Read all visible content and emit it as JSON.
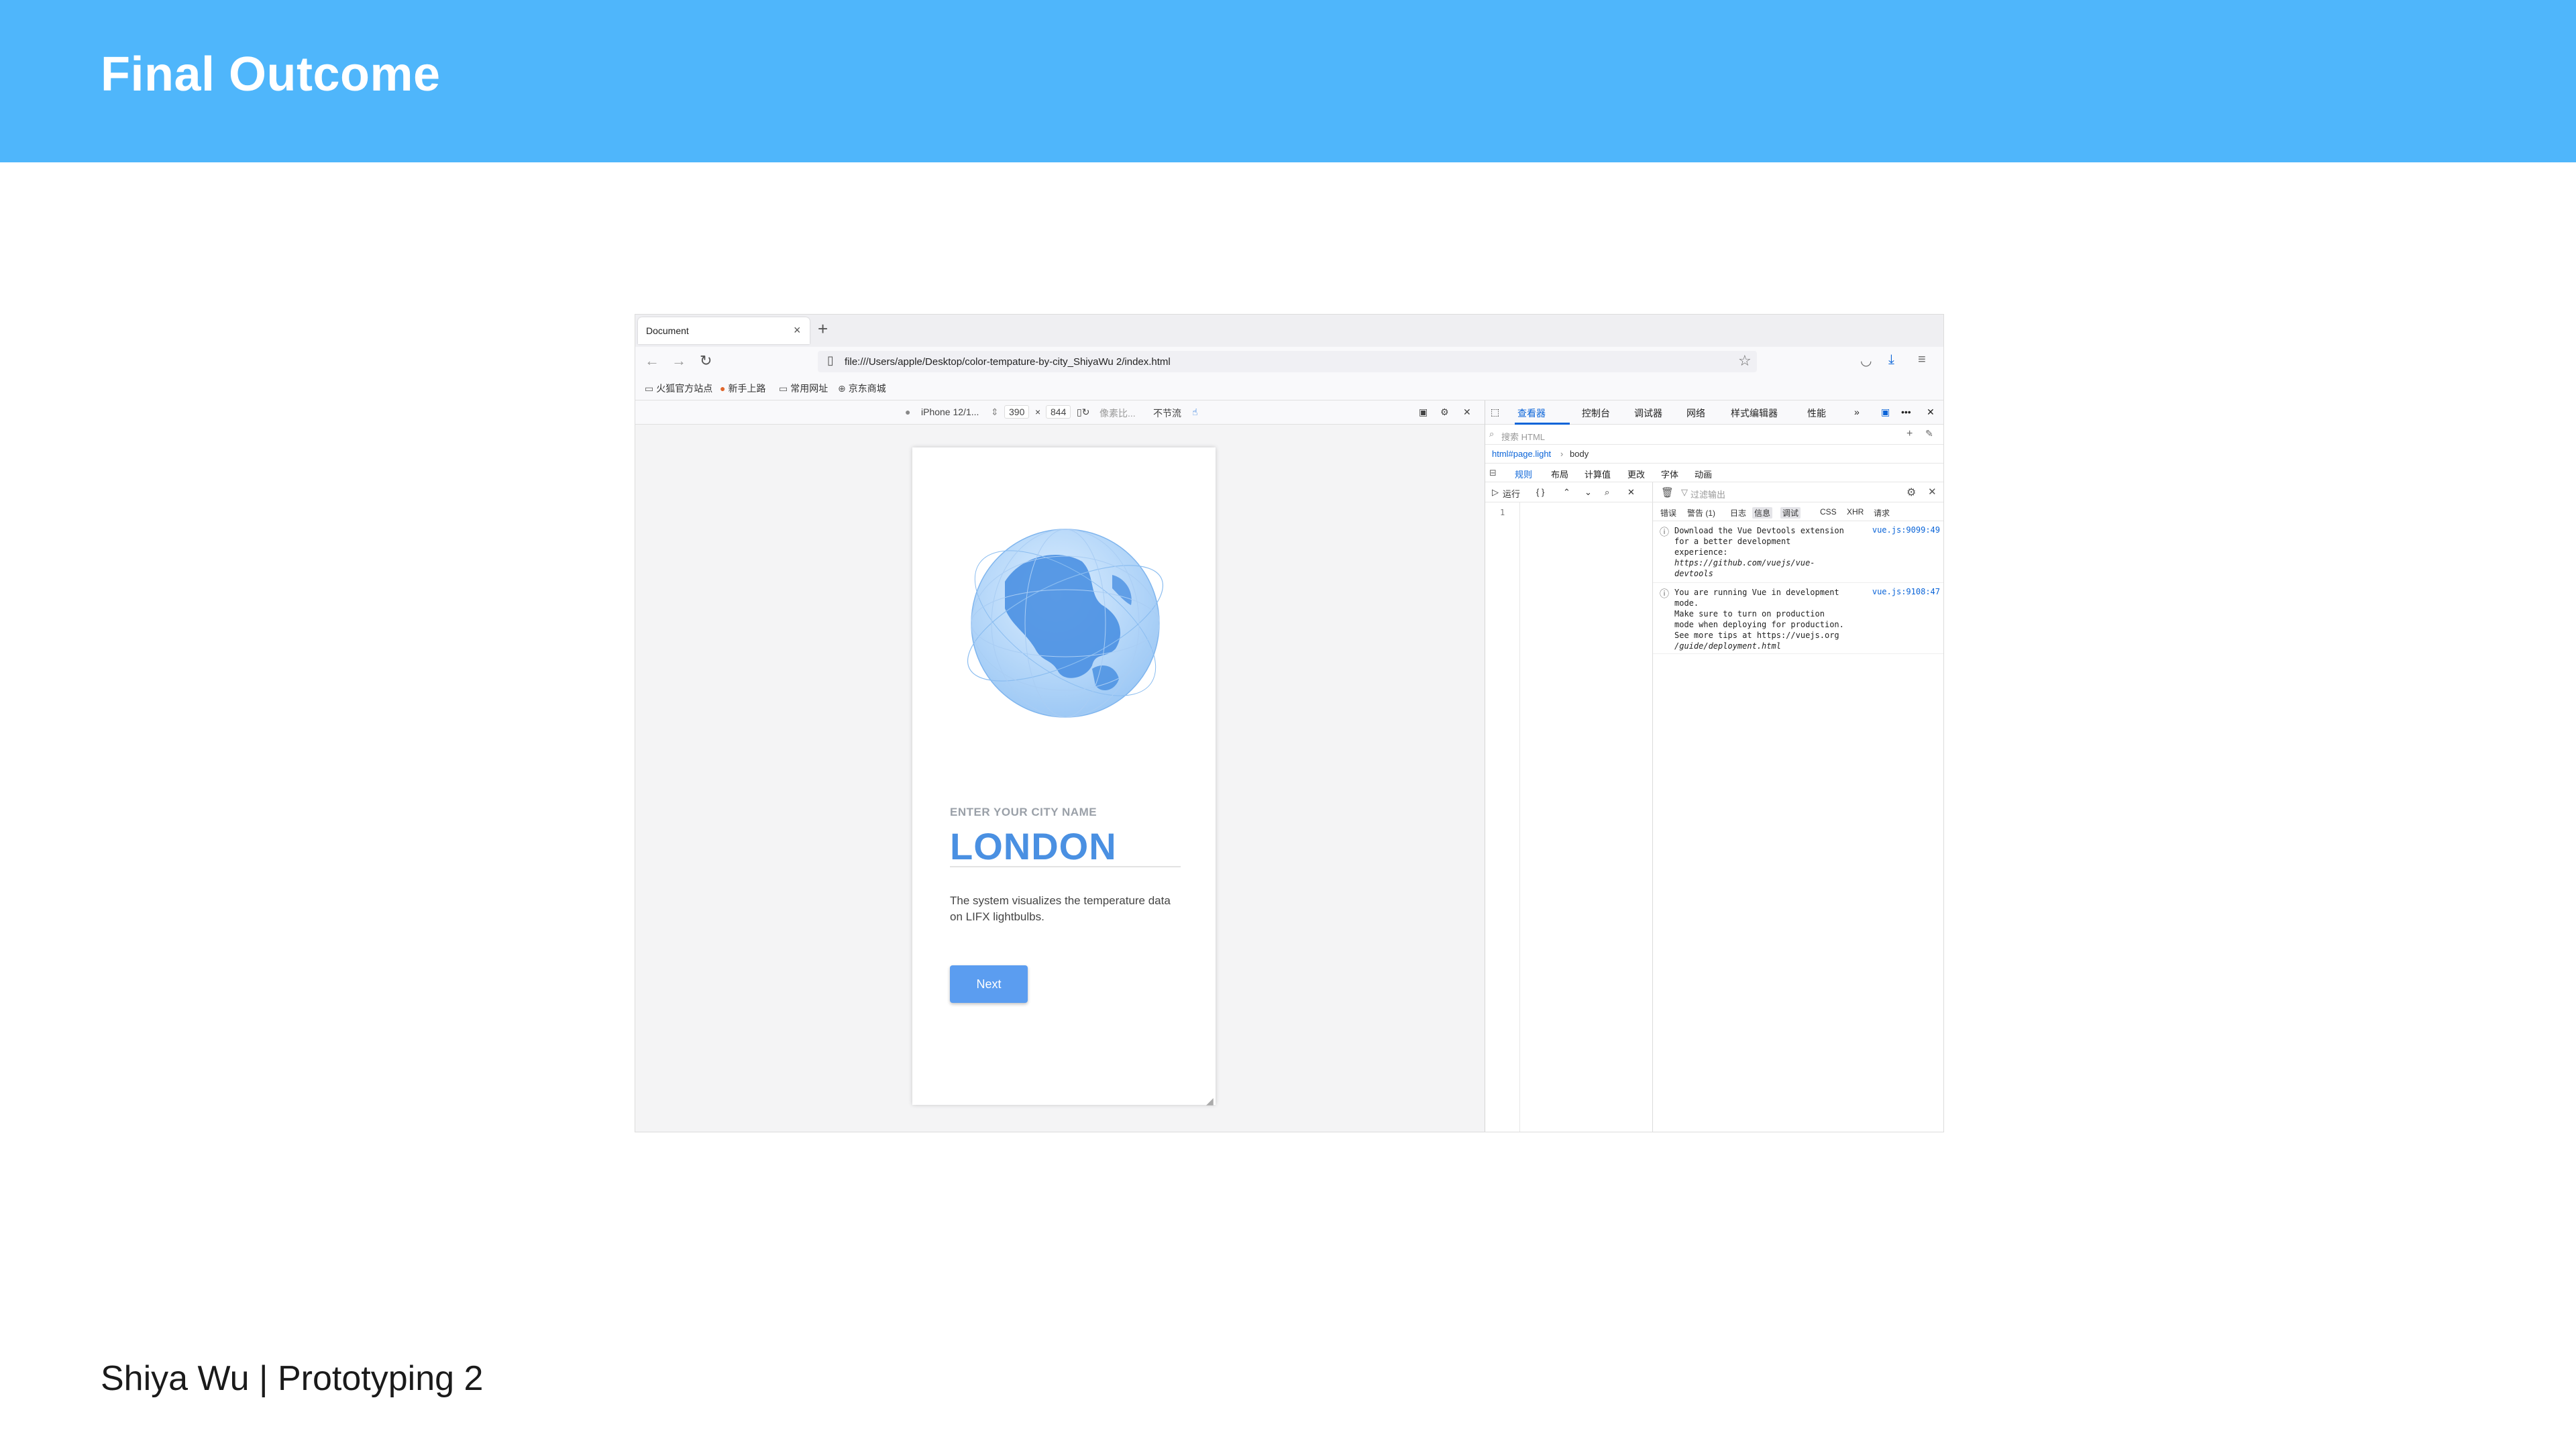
{
  "slide": {
    "title": "Final Outcome",
    "footer": "Shiya Wu | Prototyping 2",
    "header_color": "#4fb6fb"
  },
  "browser": {
    "tab_title": "Document",
    "tab_close": "×",
    "new_tab": "+",
    "url": "file:///Users/apple/Desktop/color-tempature-by-city_ShiyaWu 2/index.html",
    "bookmarks": [
      "火狐官方站点",
      "新手上路",
      "常用网址",
      "京东商城"
    ]
  },
  "rdm": {
    "device": "iPhone 12/1...",
    "width": "390",
    "times": "×",
    "height": "844",
    "dpr": "像素比...",
    "throttle": "不节流"
  },
  "app": {
    "city_label": "ENTER YOUR CITY NAME",
    "city_value": "LONDON",
    "description": "The system visualizes the temperature data on LIFX lightbulbs.",
    "next_label": "Next",
    "accent": "#4a90e2",
    "button_color": "#5b9df0"
  },
  "devtools": {
    "tabs": [
      "查看器",
      "控制台",
      "调试器",
      "网络",
      "样式编辑器",
      "性能"
    ],
    "selected_tab": "查看器",
    "html_search_placeholder": "搜索 HTML",
    "breadcrumbs": [
      "html#page.light",
      "body"
    ],
    "sub_tabs": [
      "规则",
      "布局",
      "计算值",
      "更改",
      "字体",
      "动画"
    ],
    "editor": {
      "run_label": "运行",
      "braces": "{ }",
      "line_number": "1"
    },
    "console": {
      "filter_placeholder": "过滤输出",
      "levels": [
        "错误",
        "警告 (1)",
        "日志",
        "信息",
        "调试",
        "CSS",
        "XHR",
        "请求"
      ],
      "messages": [
        {
          "lines": [
            "Download the Vue Devtools extension",
            "for a better development",
            "experience:",
            "https://github.com/vuejs/vue-",
            "devtools"
          ],
          "source": "vue.js:9099:49"
        },
        {
          "lines": [
            "You are running Vue in development",
            "mode.",
            "Make sure to turn on production",
            "mode when deploying for production.",
            "See more tips at https://vuejs.org",
            "/guide/deployment.html"
          ],
          "source": "vue.js:9108:47"
        }
      ]
    }
  },
  "icons": [
    "back-arrow-icon",
    "forward-arrow-icon",
    "reload-icon",
    "page-icon",
    "star-icon",
    "pocket-icon",
    "download-icon",
    "menu-icon",
    "folder-icon",
    "globe-icon",
    "settings-icon",
    "close-icon",
    "picker-icon",
    "trash-icon",
    "info-icon"
  ]
}
